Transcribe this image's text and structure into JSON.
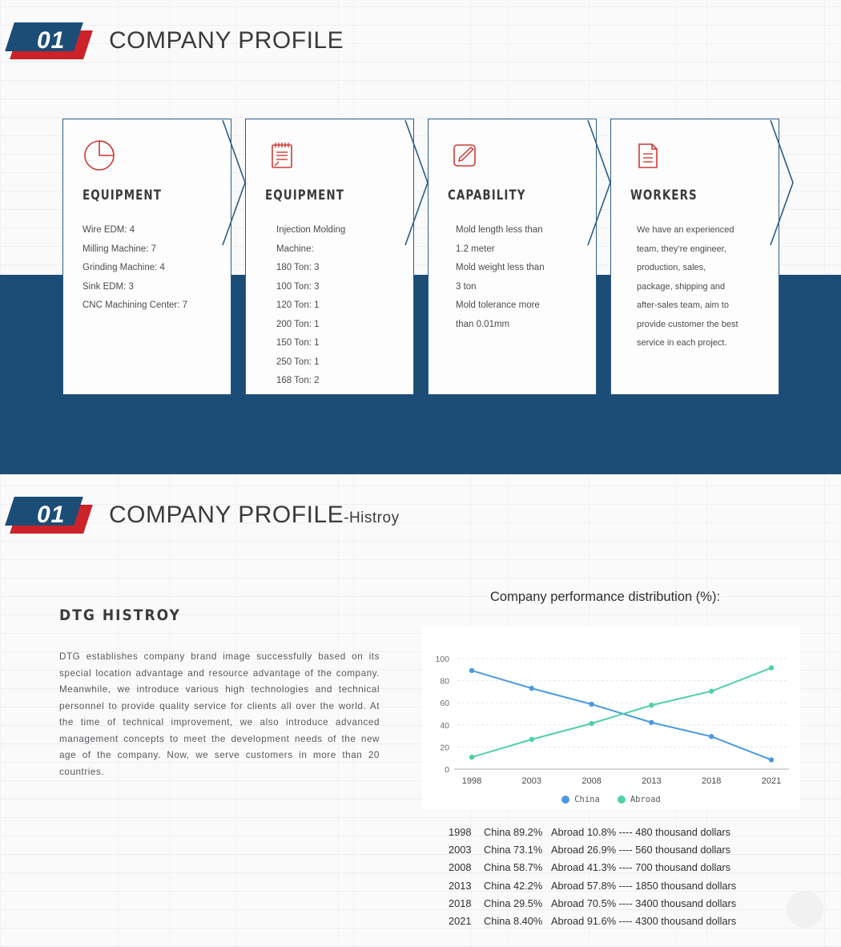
{
  "theme": {
    "navy": "#1c4d77",
    "red": "#cc2229",
    "china_color": "#4a9ae0",
    "abroad_color": "#4fd1a5",
    "page_bg": "#fafafa"
  },
  "sections": [
    {
      "number": "01",
      "title": "COMPANY PROFILE",
      "subtitle": ""
    },
    {
      "number": "01",
      "title": "COMPANY PROFILE",
      "subtitle": "-Histroy"
    }
  ],
  "cards": [
    {
      "icon": "pie-chart-icon",
      "title": "EQUIPMENT",
      "lines": [
        "Wire EDM: 4",
        "Milling Machine: 7",
        "Grinding Machine: 4",
        "Sink EDM: 3",
        "CNC Machining Center: 7"
      ]
    },
    {
      "icon": "notepad-icon",
      "title": "EQUIPMENT",
      "lines": [
        "Injection Molding",
        "Machine:",
        "180 Ton: 3",
        "100 Ton: 3",
        "120 Ton: 1",
        "200 Ton: 1",
        "150 Ton: 1",
        "250 Ton: 1",
        "168 Ton: 2"
      ]
    },
    {
      "icon": "pencil-square-icon",
      "title": "CAPABILITY",
      "lines": [
        "Mold length less than",
        "1.2 meter",
        "Mold weight less than",
        "3 ton",
        "Mold tolerance more",
        "than 0.01mm"
      ]
    },
    {
      "icon": "document-icon",
      "title": "WORKERS",
      "lines": [
        "We have an experienced",
        "team, they’re engineer,",
        "production, sales,",
        "package, shipping and",
        "after-sales team, aim to",
        "provide customer the best",
        "service in each project."
      ]
    }
  ],
  "history": {
    "title": "DTG  HISTROY",
    "paragraph": "DTG establishes company brand image successfully based on its special location advantage and resource advantage of the company. Meanwhile, we introduce various high technologies and technical personnel to provide quality service for clients all over the world. At the time of technical improvement, we also introduce advanced management concepts to meet the development needs of the new age of the company. Now, we serve customers in more than 20 countries."
  },
  "chart_data": {
    "type": "line",
    "title": "Company performance distribution (%):",
    "xlabel": "",
    "ylabel": "",
    "categories": [
      "1998",
      "2003",
      "2008",
      "2013",
      "2018",
      "2021"
    ],
    "series": [
      {
        "name": "China",
        "values": [
          89.2,
          73.1,
          58.7,
          42.2,
          29.5,
          8.4
        ],
        "color": "#4a9ae0"
      },
      {
        "name": "Abroad",
        "values": [
          10.8,
          26.9,
          41.3,
          57.8,
          70.5,
          91.6
        ],
        "color": "#4fd1a5"
      }
    ],
    "ylim": [
      0,
      100
    ],
    "yticks": [
      "0",
      "20",
      "40",
      "60",
      "80",
      "100"
    ],
    "grid": true,
    "legend_position": "bottom"
  },
  "data_rows": [
    {
      "year": "1998",
      "china": "China 89.2%",
      "abroad": "Abroad 10.8% ---- 480 thousand dollars"
    },
    {
      "year": "2003",
      "china": "China 73.1%",
      "abroad": "Abroad 26.9% ---- 560 thousand dollars"
    },
    {
      "year": "2008",
      "china": "China 58.7%",
      "abroad": "Abroad 41.3% ---- 700 thousand dollars"
    },
    {
      "year": "2013",
      "china": "China 42.2%",
      "abroad": "Abroad 57.8% ---- 1850 thousand dollars"
    },
    {
      "year": "2018",
      "china": "China 29.5%",
      "abroad": "Abroad 70.5% ---- 3400 thousand dollars"
    },
    {
      "year": "2021",
      "china": "China 8.40%",
      "abroad": "Abroad 91.6% ---- 4300 thousand dollars"
    }
  ]
}
